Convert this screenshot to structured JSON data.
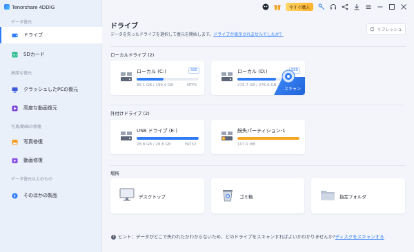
{
  "app": {
    "name": "Tenorshare 4DDIG"
  },
  "toolbar": {
    "buy_label": "今すぐ購入"
  },
  "sidebar": {
    "sections": [
      {
        "label": "データ復元"
      },
      {
        "label": "高度な復元"
      },
      {
        "label": "写真/動画の修復"
      },
      {
        "label": "データ復元以上のもの"
      }
    ],
    "items": [
      {
        "label": "ドライブ"
      },
      {
        "label": "SDカード"
      },
      {
        "label": "クラッシュしたPCの復元"
      },
      {
        "label": "高度な動画復元"
      },
      {
        "label": "写真修復"
      },
      {
        "label": "動画修復"
      },
      {
        "label": "そのほかの製品"
      }
    ]
  },
  "main": {
    "title": "ドライブ",
    "subtitle": "データを失ったドライブを選択して復元を開始します。",
    "subtitle_link": "ドライブが表示されませんでしたか？",
    "refresh_label": "リフレッシュ",
    "local_group": "ローカルドライブ (2)",
    "external_group": "外付けドライブ (2)",
    "location_group": "場所",
    "local_drives": [
      {
        "name": "ローカル (C:)",
        "size": "85.1 GB / 199.4 GB",
        "fs": "NTFS",
        "badge": "SSD",
        "usage": 0.43
      },
      {
        "name": "ローカル (D:)",
        "size": "215.7 GB / 276.6 GB",
        "fs": "NTFS",
        "badge": "SSD",
        "usage": 0.78,
        "scan_label": "スキャン"
      }
    ],
    "external_drives": [
      {
        "name": "USB ドライブ (E:)",
        "size": "28.8 GB / 28.8 GB",
        "fs": "FAT32",
        "usage": 1.0
      },
      {
        "name": "紛失パーティション-1",
        "size": "107.0 MB",
        "usage": 1.0
      }
    ],
    "locations": [
      {
        "name": "デスクトップ"
      },
      {
        "name": "ゴミ箱"
      },
      {
        "name": "指定フォルダ"
      }
    ],
    "hint_text": "ヒント：データがどこで失われたかわからないため、どのドライブをスキャンすればよいかわかりませんか?",
    "hint_link": "ディスクをスキャンする"
  },
  "colors": {
    "accent": "#2f7cf6",
    "warning": "#f5a623",
    "sidebar_bg": "#eaf0fa",
    "main_bg": "#f3f5fa"
  }
}
